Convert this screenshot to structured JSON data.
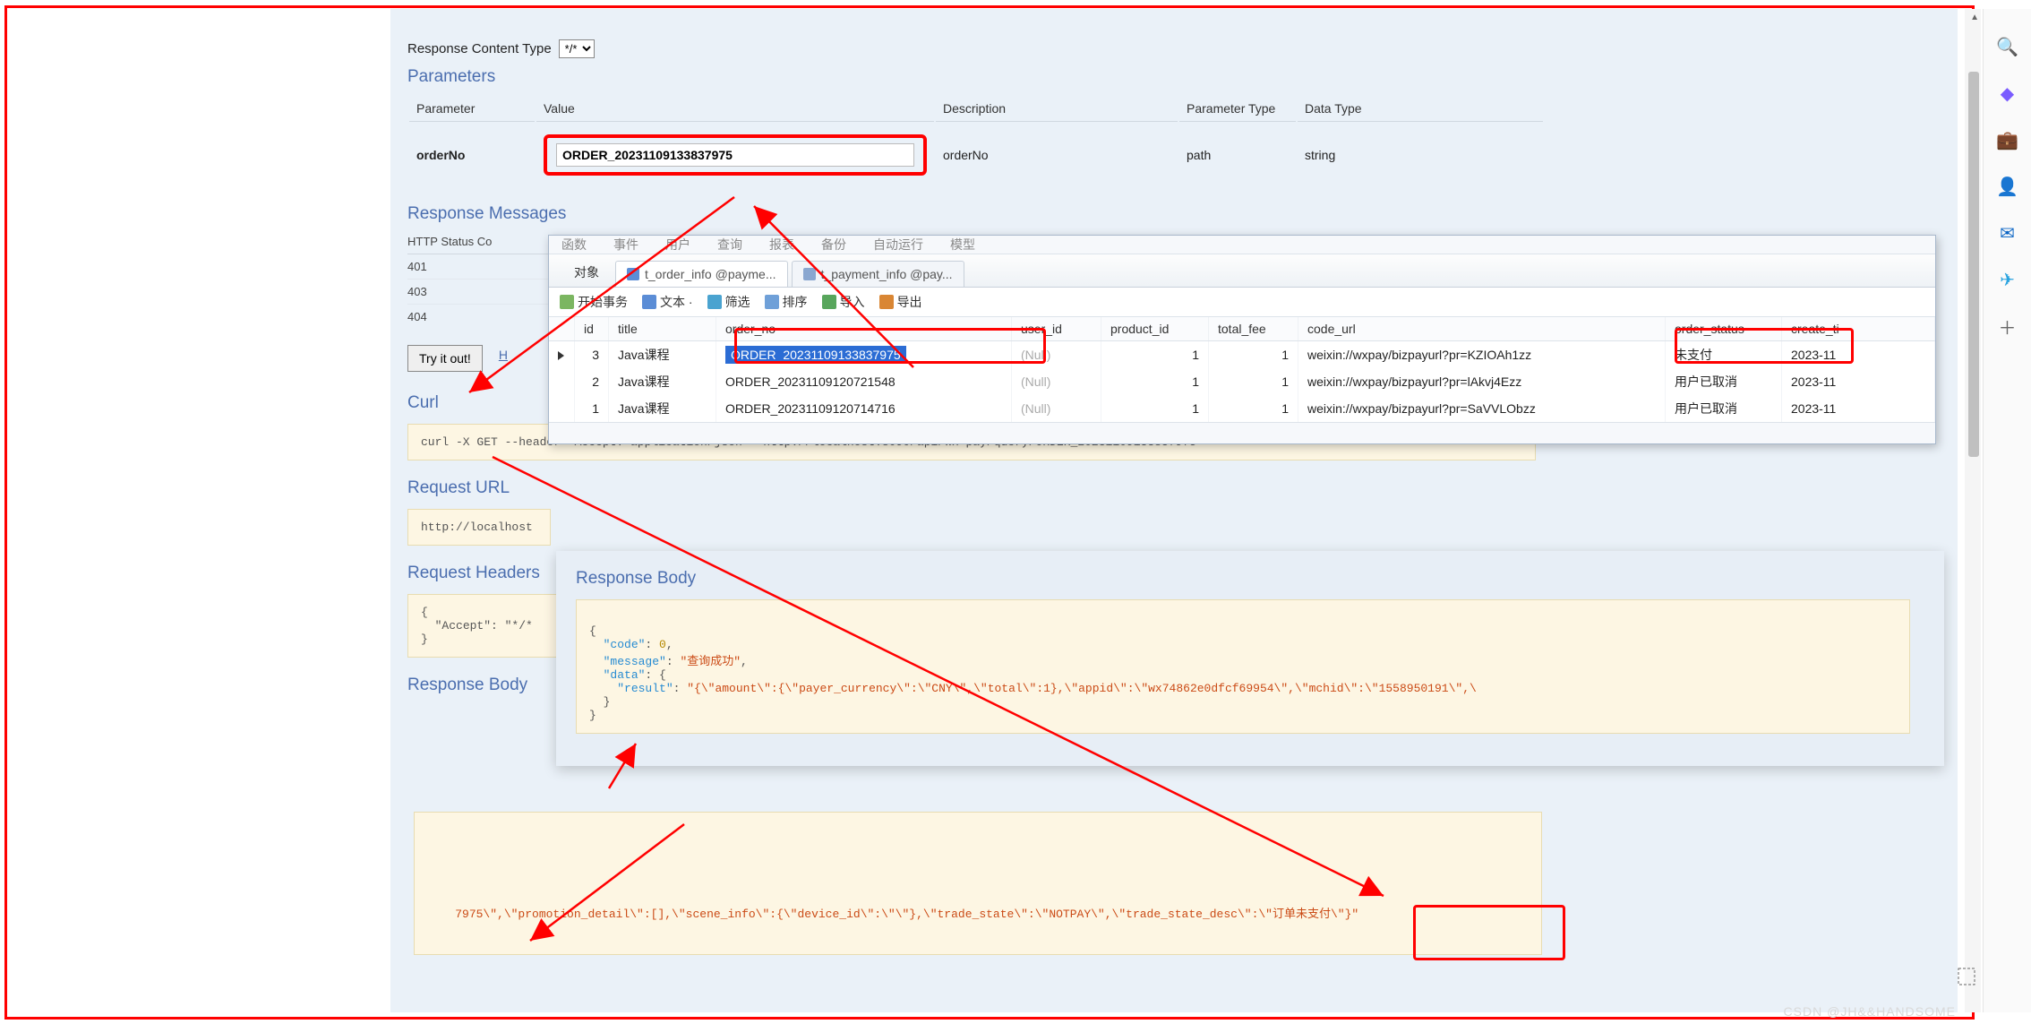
{
  "sidebar_icons": [
    "search-icon",
    "diamond-icon",
    "briefcase-icon",
    "person-icon",
    "outlook-icon",
    "telegram-icon",
    "plus-icon"
  ],
  "sections": {
    "content_type_label": "Response Content Type",
    "content_type_value": "*/*",
    "parameters_heading": "Parameters",
    "response_messages_heading": "Response Messages",
    "http_status_heading": "HTTP Status Co",
    "curl_heading": "Curl",
    "request_url_heading": "Request URL",
    "request_headers_heading": "Request Headers",
    "response_body_heading": "Response Body"
  },
  "param_headers": {
    "parameter": "Parameter",
    "value": "Value",
    "description": "Description",
    "param_type": "Parameter Type",
    "data_type": "Data Type"
  },
  "param_row": {
    "name": "orderNo",
    "value": "ORDER_20231109133837975",
    "description": "orderNo",
    "param_type": "path",
    "data_type": "string"
  },
  "status_codes": [
    "401",
    "403",
    "404"
  ],
  "try_button": "Try it out!",
  "h_link": "H",
  "curl_cmd": "curl -X GET --header 'Accept: application/json' 'http://localhost:8090/api/wx-pay/query/ORDER_20231109133837975'",
  "request_url_value": "http://localhost",
  "request_headers_block": "{\n  \"Accept\": \"*/*\n}",
  "db": {
    "topmenu": [
      "函数",
      "事件",
      "用户",
      "查询",
      "报表",
      "备份",
      "自动运行",
      "模型"
    ],
    "tab_left": "对象",
    "tabs": [
      {
        "label": "t_order_info @payme...",
        "active": true
      },
      {
        "label": "t_payment_info @pay...",
        "active": false
      }
    ],
    "toolbar": [
      {
        "icon": "begin-tx-icon",
        "label": "开始事务"
      },
      {
        "icon": "text-icon",
        "label": "文本 ·"
      },
      {
        "icon": "filter-icon",
        "label": "筛选"
      },
      {
        "icon": "sort-icon",
        "label": "排序"
      },
      {
        "icon": "import-icon",
        "label": "导入"
      },
      {
        "icon": "export-icon",
        "label": "导出"
      }
    ],
    "columns": [
      "id",
      "title",
      "order_no",
      "user_id",
      "product_id",
      "total_fee",
      "code_url",
      "order_status",
      "create_ti"
    ],
    "rows": [
      {
        "marker": true,
        "id": "3",
        "title": "Java课程",
        "order_no": "ORDER_20231109133837975",
        "user_id": "(Null)",
        "product_id": "1",
        "total_fee": "1",
        "code_url": "weixin://wxpay/bizpayurl?pr=KZIOAh1zz",
        "order_status": "未支付",
        "create_ti": "2023-11"
      },
      {
        "marker": false,
        "id": "2",
        "title": "Java课程",
        "order_no": "ORDER_20231109120721548",
        "user_id": "(Null)",
        "product_id": "1",
        "total_fee": "1",
        "code_url": "weixin://wxpay/bizpayurl?pr=lAkvj4Ezz",
        "order_status": "用户已取消",
        "create_ti": "2023-11"
      },
      {
        "marker": false,
        "id": "1",
        "title": "Java课程",
        "order_no": "ORDER_20231109120714716",
        "user_id": "(Null)",
        "product_id": "1",
        "total_fee": "1",
        "code_url": "weixin://wxpay/bizpayurl?pr=SaVVLObzz",
        "order_status": "用户已取消",
        "create_ti": "2023-11"
      }
    ]
  },
  "resp_panel": {
    "heading": "Response Body",
    "json": {
      "open": "{",
      "k_code": "\"code\"",
      "v_code": "0",
      "k_message": "\"message\"",
      "v_message": "\"查询成功\"",
      "k_data": "\"data\"",
      "data_open": "{",
      "k_result": "\"result\"",
      "v_result": "\"{\\\"amount\\\":{\\\"payer_currency\\\":\\\"CNY\\\",\\\"total\\\":1},\\\"appid\\\":\\\"wx74862e0dfcf69954\\\",\\\"mchid\\\":\\\"1558950191\\\",\\",
      "data_close": "}",
      "close": "}"
    }
  },
  "resp_main_text": "7975\\\",\\\"promotion_detail\\\":[],\\\"scene_info\\\":{\\\"device_id\\\":\\\"\\\"},\\\"trade_state\\\":\\\"NOTPAY\\\",\\\"trade_state_desc\\\":\\\"订单未支付\\\"}\"",
  "watermark": "CSDN @JH&&HANDSOME"
}
